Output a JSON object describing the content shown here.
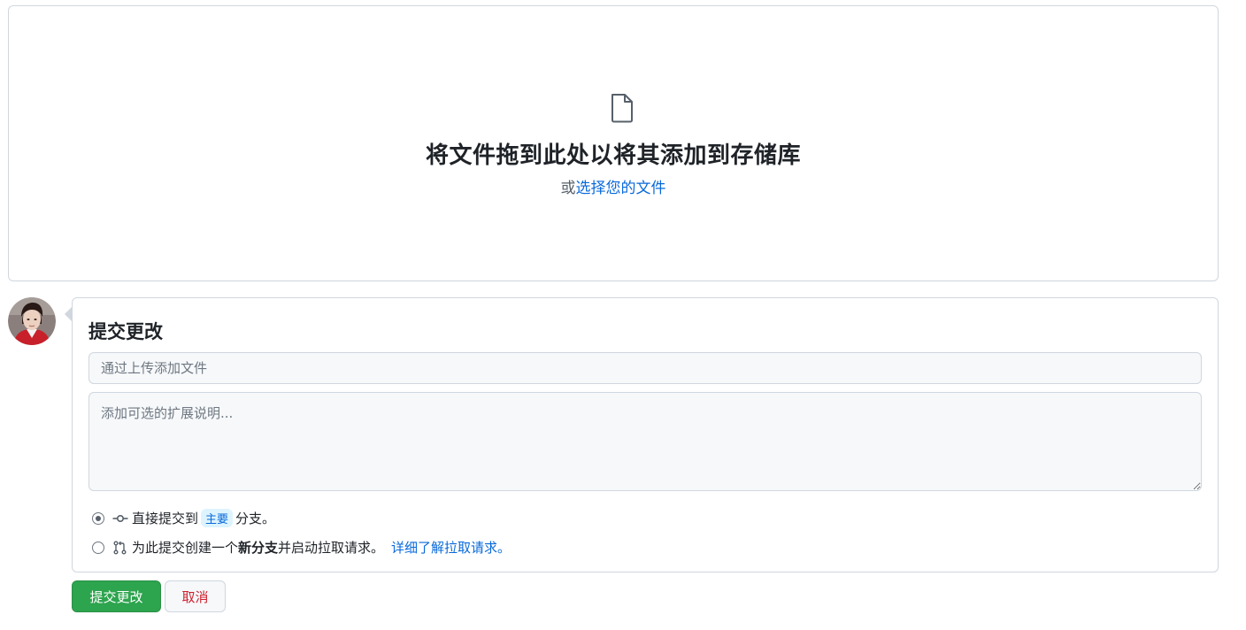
{
  "dropzone": {
    "icon": "file-icon",
    "title": "将文件拖到此处以将其添加到存储库",
    "prefix": "或",
    "choose_link": "选择您的文件"
  },
  "avatar": {
    "icon": "user-avatar"
  },
  "commit": {
    "title": "提交更改",
    "summary_placeholder": "通过上传添加文件",
    "summary_value": "",
    "description_placeholder": "添加可选的扩展说明...",
    "description_value": "",
    "options": [
      {
        "selected": true,
        "icon": "git-commit-icon",
        "text_before": "直接提交到",
        "branch": "主要",
        "text_after": "分支。"
      },
      {
        "selected": false,
        "icon": "git-pull-request-icon",
        "text_before": "为此提交创建一个",
        "bold": "新分支",
        "text_after": "并启动拉取请求。",
        "link": "详细了解拉取请求。"
      }
    ]
  },
  "buttons": {
    "commit_label": "提交更改",
    "cancel_label": "取消"
  },
  "colors": {
    "primary": "#2da44e",
    "link": "#0969da",
    "danger": "#cf222e",
    "border": "#d0d7de",
    "input_bg": "#f6f8fa"
  }
}
